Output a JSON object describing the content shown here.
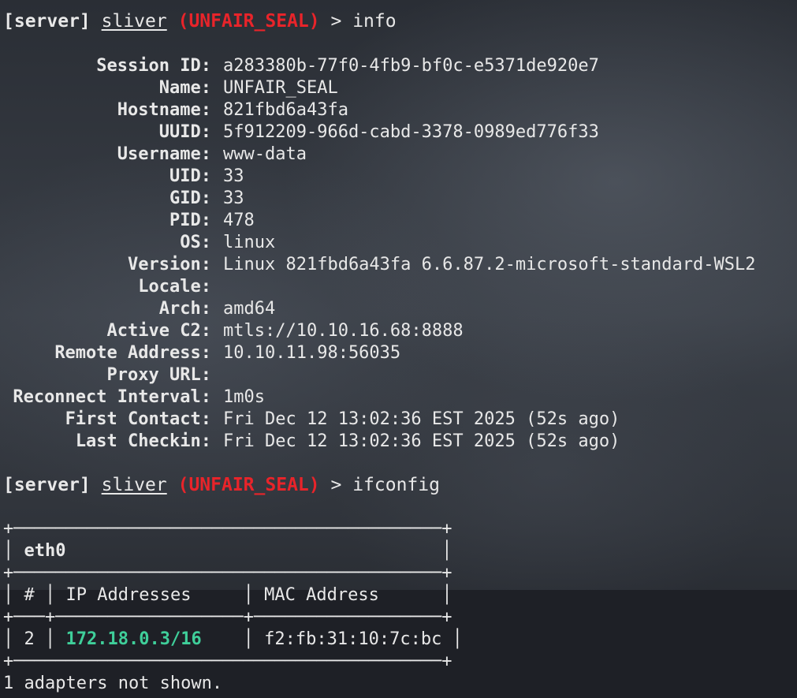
{
  "prompt": {
    "server": "[server]",
    "app": "sliver",
    "session": "(UNFAIR_SEAL)",
    "arrow": ">"
  },
  "commands": [
    "info",
    "ifconfig"
  ],
  "info": [
    {
      "label": "Session ID:",
      "value": "a283380b-77f0-4fb9-bf0c-e5371de920e7"
    },
    {
      "label": "Name:",
      "value": "UNFAIR_SEAL"
    },
    {
      "label": "Hostname:",
      "value": "821fbd6a43fa"
    },
    {
      "label": "UUID:",
      "value": "5f912209-966d-cabd-3378-0989ed776f33"
    },
    {
      "label": "Username:",
      "value": "www-data"
    },
    {
      "label": "UID:",
      "value": "33"
    },
    {
      "label": "GID:",
      "value": "33"
    },
    {
      "label": "PID:",
      "value": "478"
    },
    {
      "label": "OS:",
      "value": "linux"
    },
    {
      "label": "Version:",
      "value": "Linux 821fbd6a43fa 6.6.87.2-microsoft-standard-WSL2"
    },
    {
      "label": "Locale:",
      "value": ""
    },
    {
      "label": "Arch:",
      "value": "amd64"
    },
    {
      "label": "Active C2:",
      "value": "mtls://10.10.16.68:8888"
    },
    {
      "label": "Remote Address:",
      "value": "10.10.11.98:56035"
    },
    {
      "label": "Proxy URL:",
      "value": ""
    },
    {
      "label": "Reconnect Interval:",
      "value": "1m0s"
    },
    {
      "label": "First Contact:",
      "value": "Fri Dec 12 13:02:36 EST 2025 (52s ago)"
    },
    {
      "label": "Last Checkin:",
      "value": "Fri Dec 12 13:02:36 EST 2025 (52s ago)"
    }
  ],
  "ifconfig": {
    "border_top": "+─────────────────────────────────────────+",
    "border_mid": "+───+──────────────────+──────────────────+",
    "interface": "eth0",
    "headers": [
      "#",
      "IP Addresses",
      "MAC Address"
    ],
    "rows": [
      {
        "index": "2",
        "ip": "172.18.0.3/16",
        "mac": "f2:fb:31:10:7c:bc"
      }
    ],
    "footer": "1 adapters not shown."
  },
  "colors": {
    "session": "#e8242a",
    "ip_highlight": "#3fcf9a",
    "text": "#e8e8e8"
  }
}
